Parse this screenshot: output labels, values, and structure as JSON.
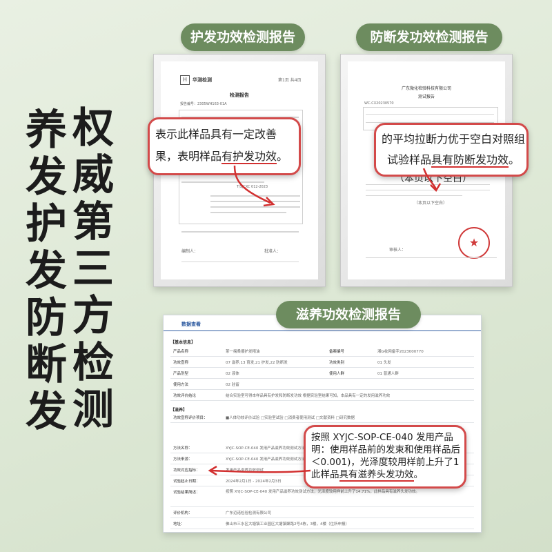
{
  "headline": {
    "right_column": "权威第三方检测",
    "left_column": "养发护发防断发"
  },
  "labels": {
    "report1": "护发功效检测报告",
    "report2": "防断发功效检测报告",
    "report3": "滋养功效检测报告"
  },
  "report1": {
    "org": "华测检测",
    "doc_title": "检测报告",
    "page": "第1页 共4页",
    "report_no": "报告编号：2305WH163-01A",
    "cert_std": "T/SJCXC 012-2023",
    "signer1": "编制人：",
    "signer2": "批准人：",
    "callout_line1": "表示此样品具有一定改善",
    "callout_line2_a": "果，表明样品",
    "callout_line2_b": "有护发功效",
    "callout_line2_c": "。"
  },
  "report2": {
    "org_name": "广东微化检验科技有限公司",
    "doc_title": "测试报告",
    "report_no": "WC-CX20230570",
    "footer_note": "（本页以下空白）",
    "signer": "审核人：",
    "callout_line1": "的平均拉断力优于空白对照组",
    "callout_line2_a": "试验样品",
    "callout_line2_b": "具有防断发功效",
    "callout_line2_c": "。",
    "callout_line3": "（本页以下空白）"
  },
  "screen": {
    "tab": "数据查看",
    "section_basic": "【基本信息】",
    "section_cosmetic": "【滋养】",
    "rows_basic": [
      {
        "label": "产品名称",
        "value": "茶一掬柔顺护发精油",
        "label2": "备案编号",
        "value2": "湘G妆网备字2023000770"
      },
      {
        "label": "功效宣称",
        "value": "07 滋养,13 育发,21 护发,22 防断发",
        "label2": "功效类别",
        "value2": "01 头发"
      },
      {
        "label": "产品剂型",
        "value": "02 液体",
        "label2": "使用人群",
        "value2": "01 普通人群"
      },
      {
        "label": "使用方法",
        "value": "02 驻留",
        "label2": "",
        "value2": ""
      },
      {
        "label": "功效评价结论",
        "value": "结合实验室可得本样品具有护发和防断发功效 根据实验室结果可知，本品具有一定的发用滋养功效",
        "label2": "",
        "value2": ""
      }
    ],
    "rows_cosmetic": [
      {
        "label": "功效宣称评价项目：",
        "value": "■人体功效评价试验 □实验室试验 □消费者使用测试 □文献资料 □研究数据"
      },
      {
        "label": "方法名称：",
        "value": "XYJC-SOP-CE-040 发用产品滋养功效测试方法"
      },
      {
        "label": "方法来源：",
        "value": "XYJC-SOP-CE-040 发用产品滋养功效测试方法"
      },
      {
        "label": "功效对应指标：",
        "value": "发用产品滋养功效测试"
      },
      {
        "label": "试验起止日期：",
        "value": "2024年2月1日 - 2024年2月3日"
      },
      {
        "label": "试验结果简述：",
        "value": "按照 XYJC-SOP-CE-040 发用产品滋养功效测试方法，光泽度较用样前上升了14.71%，此样品具有滋养头发功效。"
      },
      {
        "label": "评价机构：",
        "value": "广东迈诺检验检测有限公司"
      },
      {
        "label": "地址：",
        "value": "佛山市三水区大塘镇工业园区大塘镇聚路2号4栋，3楼，4楼（住所申报）"
      }
    ],
    "callout_line1": "按照 XYJC-SOP-CE-040 发用产品",
    "callout_line2": "明：使用样品前的发束和使用样品后",
    "callout_line3": "＜0.001)，光泽度较用样前上升了1",
    "callout_line4_a": "此样品",
    "callout_line4_b": "具有滋养头发功效",
    "callout_line4_c": "。"
  },
  "colors": {
    "pill": "#6d8c5f",
    "callout_border": "#d34a4a",
    "underline": "#d23030",
    "background": "#e3ecdc"
  }
}
